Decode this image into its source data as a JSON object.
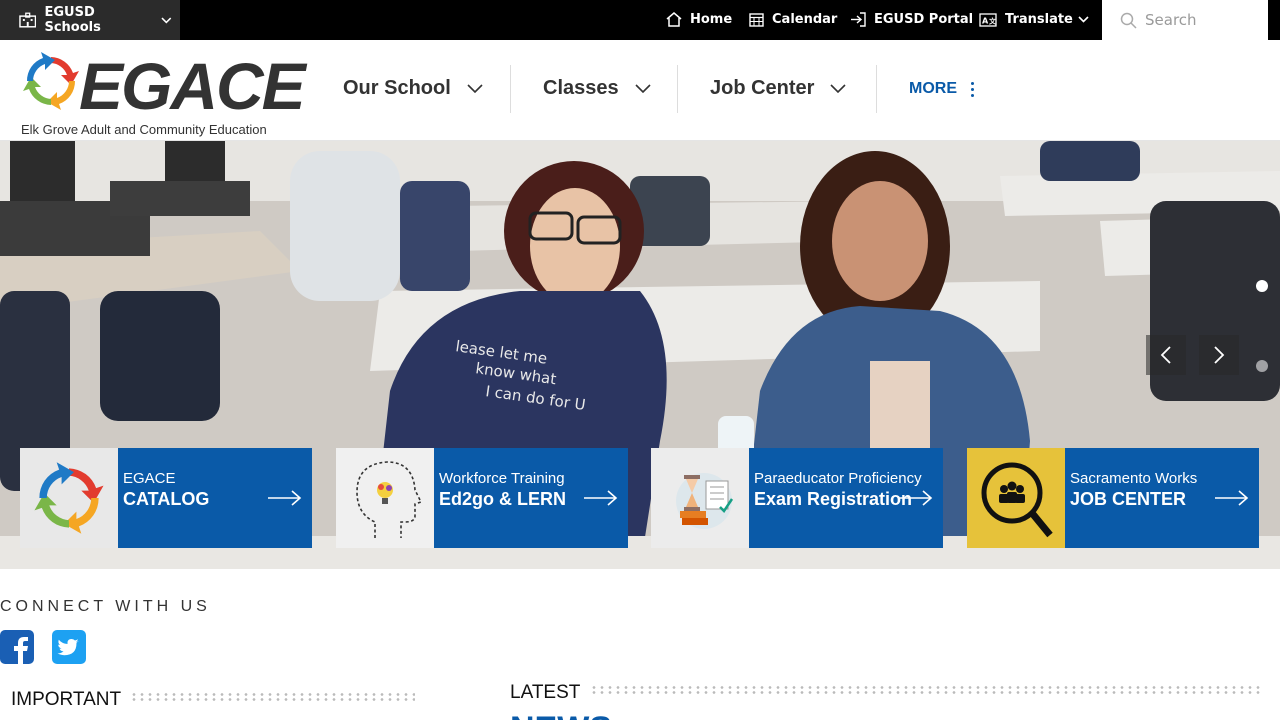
{
  "topbar": {
    "schools_label": "EGUSD Schools",
    "links": [
      {
        "label": "Home",
        "icon": "home-icon"
      },
      {
        "label": "Calendar",
        "icon": "calendar-icon"
      },
      {
        "label": "EGUSD Portal",
        "icon": "sign-in-icon"
      },
      {
        "label": "Translate",
        "icon": "translate-icon"
      }
    ],
    "search_placeholder": "Search"
  },
  "header": {
    "logo_text": "EGACE",
    "logo_subtitle": "Elk Grove Adult and Community Education",
    "nav": [
      "Our School",
      "Classes",
      "Job Center"
    ],
    "more_label": "MORE"
  },
  "hero": {
    "cards": [
      {
        "small": "EGACE",
        "big": "CATALOG",
        "icon": "egace-logo-icon"
      },
      {
        "small": "Workforce Training",
        "big": "Ed2go & LERN",
        "icon": "head-lightbulb-icon"
      },
      {
        "small": "Paraeducator Proficiency",
        "big": "Exam Registration",
        "icon": "exam-hourglass-icon"
      },
      {
        "small": "Sacramento Works",
        "big": "JOB CENTER",
        "icon": "magnifier-people-icon"
      }
    ]
  },
  "connect": {
    "title": "CONNECT WITH US",
    "networks": [
      "facebook-icon",
      "twitter-icon"
    ]
  },
  "sections": {
    "important": "IMPORTANT",
    "latest": "LATEST",
    "news": "NEWS"
  },
  "colors": {
    "brand_blue": "#0a5aa8",
    "topbar": "#000000",
    "schools_bg": "#2b2b2b"
  }
}
